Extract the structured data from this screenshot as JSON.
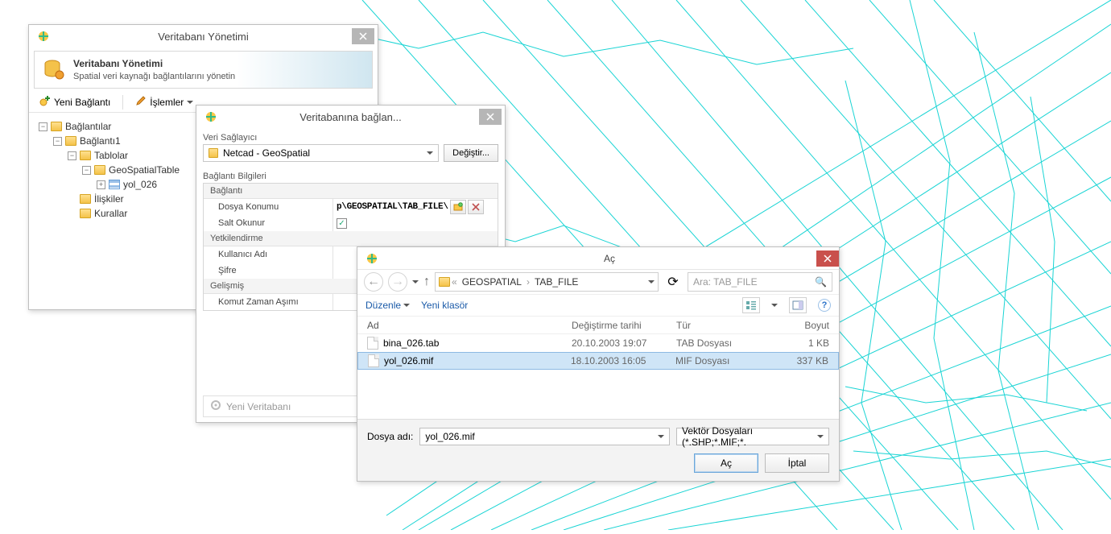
{
  "db_win": {
    "title": "Veritabanı Yönetimi",
    "header_title": "Veritabanı Yönetimi",
    "header_sub": "Spatial veri kaynağı bağlantılarını yönetin",
    "toolbar": {
      "new_connection": "Yeni Bağlantı",
      "operations": "İşlemler"
    },
    "tree": {
      "root": "Bağlantılar",
      "connection": "Bağlantı1",
      "tables": "Tablolar",
      "geo_table": "GeoSpatialTable",
      "layer": "yol_026",
      "relations": "İlişkiler",
      "rules": "Kurallar"
    }
  },
  "conn_win": {
    "title": "Veritabanına bağlan...",
    "provider_label": "Veri Sağlayıcı",
    "provider_value": "Netcad - GeoSpatial",
    "change_btn": "Değiştir...",
    "info_label": "Bağlantı Bilgileri",
    "groups": {
      "connection": "Bağlantı",
      "file_location": "Dosya Konumu",
      "file_path": "p\\GEOSPATIAL\\TAB_FILE\\",
      "readonly": "Salt Okunur",
      "readonly_checked": true,
      "auth": "Yetkilendirme",
      "username": "Kullanıcı Adı",
      "password": "Şifre",
      "advanced": "Gelişmiş",
      "timeout": "Komut Zaman Aşımı"
    },
    "footer": "Yeni Veritabanı"
  },
  "open_win": {
    "title": "Aç",
    "breadcrumb": {
      "seg1": "GEOSPATIAL",
      "seg2": "TAB_FILE"
    },
    "search_placeholder": "Ara: TAB_FILE",
    "organize": "Düzenle",
    "new_folder": "Yeni klasör",
    "cols": {
      "name": "Ad",
      "date": "Değiştirme tarihi",
      "type": "Tür",
      "size": "Boyut"
    },
    "files": [
      {
        "name": "bina_026.tab",
        "date": "20.10.2003 19:07",
        "type": "TAB Dosyası",
        "size": "1 KB",
        "selected": false
      },
      {
        "name": "yol_026.mif",
        "date": "18.10.2003 16:05",
        "type": "MIF Dosyası",
        "size": "337 KB",
        "selected": true
      }
    ],
    "filename_label": "Dosya adı:",
    "filename_value": "yol_026.mif",
    "filter": "Vektör Dosyaları (*.SHP;*.MIF;*.",
    "open_btn": "Aç",
    "cancel_btn": "İptal"
  }
}
